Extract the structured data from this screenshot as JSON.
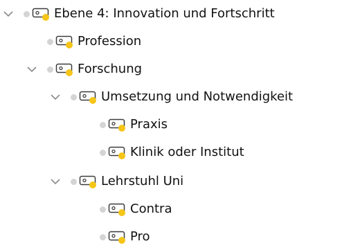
{
  "tree": {
    "nodes": [
      {
        "label": "Ebene 4: Innovation und  Fortschritt",
        "level": 0,
        "expanded": true
      },
      {
        "label": "Profession",
        "level": 1,
        "expanded": null
      },
      {
        "label": "Forschung",
        "level": 1,
        "expanded": true
      },
      {
        "label": "Umsetzung und Notwendigkeit",
        "level": 2,
        "expanded": true
      },
      {
        "label": "Praxis",
        "level": 3,
        "expanded": null
      },
      {
        "label": "Klinik oder Institut",
        "level": 3,
        "expanded": null
      },
      {
        "label": "Lehrstuhl Uni",
        "level": 2,
        "expanded": true
      },
      {
        "label": "Contra",
        "level": 3,
        "expanded": null
      },
      {
        "label": "Pro",
        "level": 3,
        "expanded": null
      }
    ]
  },
  "colors": {
    "chevron": "#8a8a8a",
    "status_dot": "#d4d4d4",
    "code_icon_outline": "#3c3c3c",
    "code_icon_badge": "#f5c518"
  }
}
